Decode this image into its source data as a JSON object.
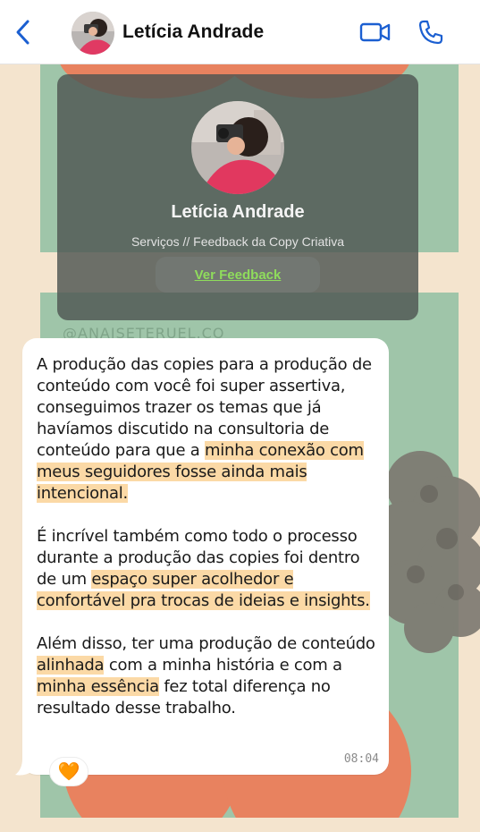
{
  "header": {
    "contact_name": "Letícia Andrade"
  },
  "card": {
    "name": "Letícia Andrade",
    "subtitle": "Serviços // Feedback da Copy Criativa",
    "button_label": "Ver Feedback"
  },
  "background": {
    "watermark_text": "@ANAISETERUEL.CO"
  },
  "message": {
    "p1_a": "A produção das copies para a produção de conteúdo com você foi super assertiva, conseguimos trazer os temas que já havíamos discutido na consultoria de conteúdo para que a ",
    "p1_hl": "minha conexão com meus seguidores fosse ainda mais intencional.",
    "p2_a": "É incrível também como todo o processo durante a produção das copies foi dentro de um ",
    "p2_hl": "espaço super acolhedor e confortável pra trocas de ideias e insights.",
    "p3_a": "Além disso, ter uma produção de conteúdo ",
    "p3_hl1": "alinhada",
    "p3_b": " com a minha história e com a ",
    "p3_hl2": "minha essência",
    "p3_c": " fez total diferença no resultado desse trabalho.",
    "time": "08:04",
    "reaction": "🧡"
  },
  "colors": {
    "accent": "#1b5fd1",
    "highlight": "#fbd9a6",
    "link_green": "#8fdc5c"
  }
}
